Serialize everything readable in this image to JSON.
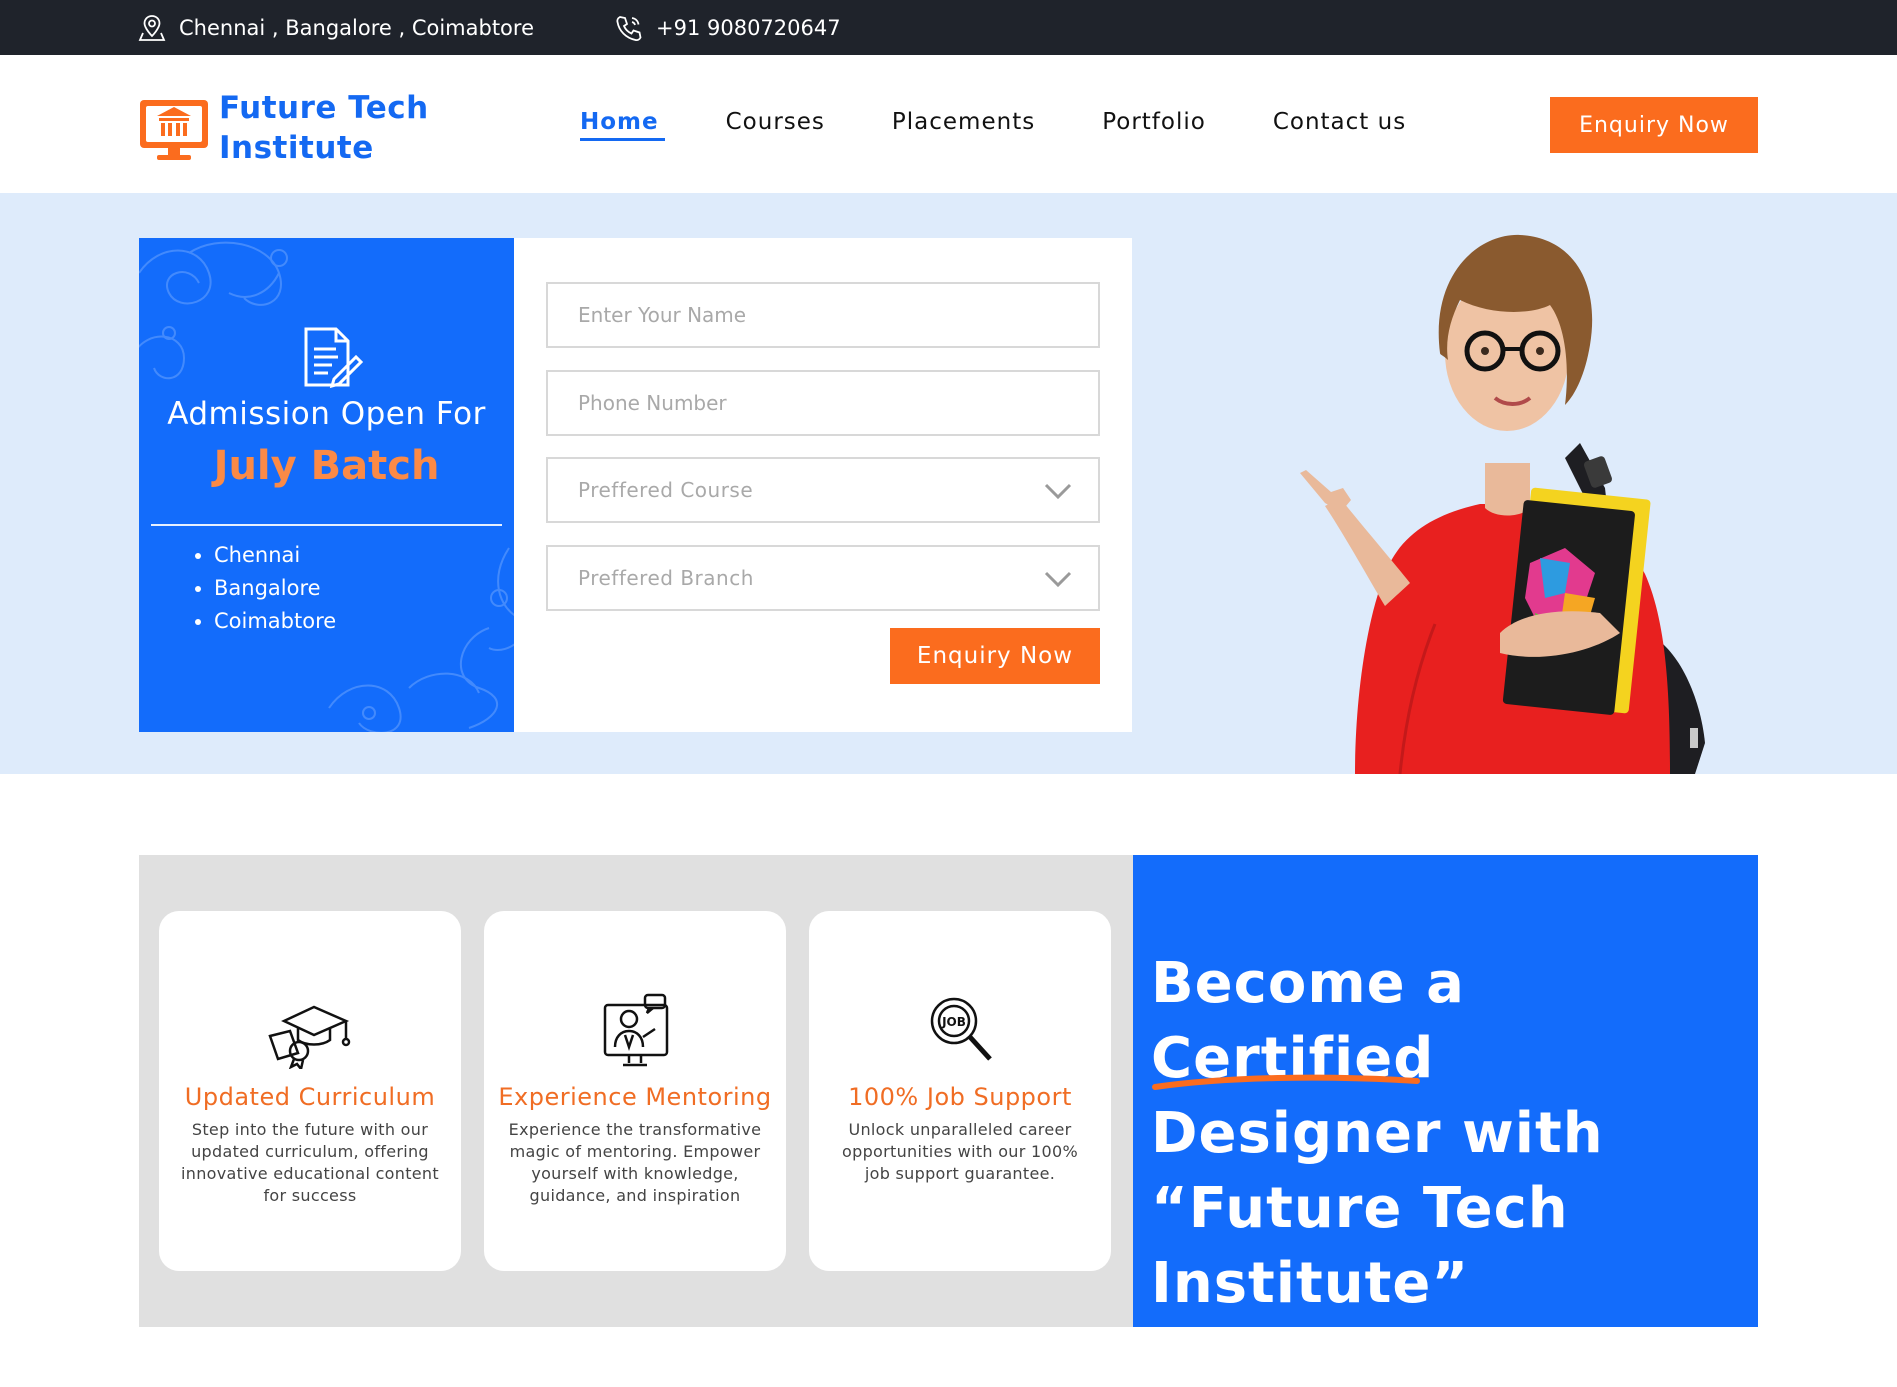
{
  "topbar": {
    "locations": "Chennai , Bangalore , Coimabtore",
    "phone": "+91 9080720647"
  },
  "header": {
    "logo_line1": "Future Tech",
    "logo_line2": "Institute",
    "nav": [
      "Home",
      "Courses",
      "Placements",
      "Portfolio",
      "Contact us"
    ],
    "active_nav": "Home",
    "enquiry_label": "Enquiry Now"
  },
  "hero": {
    "promo": {
      "title": "Admission Open For",
      "batch": "July Batch",
      "cities": [
        "Chennai",
        "Bangalore",
        "Coimabtore"
      ]
    },
    "form": {
      "name_placeholder": "Enter Your Name",
      "phone_placeholder": "Phone Number",
      "course_placeholder": "Preffered Course",
      "branch_placeholder": "Preffered Branch",
      "submit_label": "Enquiry Now"
    }
  },
  "features": [
    {
      "icon": "graduation-cap-icon",
      "title": "Updated Curriculum",
      "desc": "Step into the future with our updated curriculum, offering innovative educational content for success"
    },
    {
      "icon": "mentor-icon",
      "title": "Experience Mentoring",
      "desc": "Experience the transformative magic of mentoring. Empower yourself with knowledge, guidance, and inspiration"
    },
    {
      "icon": "job-search-icon",
      "title": "100% Job Support",
      "desc": "Unlock unparalleled career opportunities with our 100% job support guarantee."
    }
  ],
  "certified": {
    "line1": "Become a Certified",
    "line2_highlight": "Designer",
    "line2_rest": " with",
    "line3": "“Future Tech",
    "line4": "Institute”"
  },
  "colors": {
    "brand_blue": "#136cfb",
    "accent_orange": "#fb6c1e",
    "topbar": "#1f232b",
    "hero_bg": "#deebfb"
  }
}
